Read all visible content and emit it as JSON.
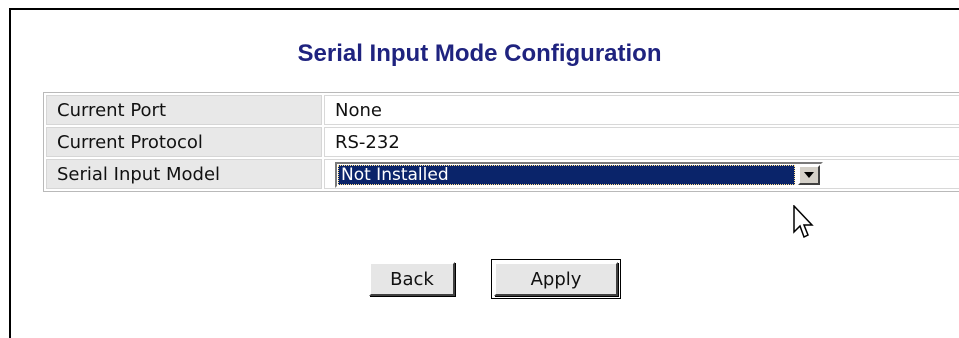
{
  "page": {
    "title": "Serial Input Mode Configuration"
  },
  "config": {
    "rows": [
      {
        "label": "Current Port",
        "value": "None"
      },
      {
        "label": "Current Protocol",
        "value": "RS-232"
      },
      {
        "label": "Serial Input Model",
        "value": "Not Installed"
      }
    ]
  },
  "buttons": {
    "back_label": "Back",
    "apply_label": "Apply"
  },
  "colors": {
    "title": "#1f237f",
    "selection_bg": "#0a246a",
    "label_cell_bg": "#e8e8e8"
  }
}
